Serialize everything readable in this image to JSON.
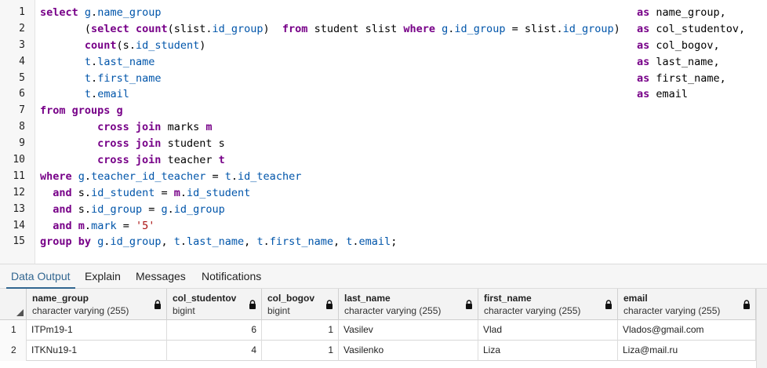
{
  "editor": {
    "lines": [
      {
        "num": "1",
        "code": [
          [
            "kw",
            "select "
          ],
          [
            "qual",
            "g"
          ],
          [
            "dot",
            "."
          ],
          [
            "qual",
            "name_group"
          ]
        ],
        "alias": [
          [
            "kw",
            "as "
          ],
          [
            "plain",
            "name_group,"
          ]
        ]
      },
      {
        "num": "2",
        "code": [
          [
            "plain",
            "       ("
          ],
          [
            "kw",
            "select "
          ],
          [
            "kw",
            "count"
          ],
          [
            "plain",
            "(slist"
          ],
          [
            "dot",
            "."
          ],
          [
            "qual",
            "id_group"
          ],
          [
            "plain",
            ")  "
          ],
          [
            "kw",
            "from "
          ],
          [
            "plain",
            "student slist "
          ],
          [
            "kw",
            "where "
          ],
          [
            "qual",
            "g"
          ],
          [
            "dot",
            "."
          ],
          [
            "qual",
            "id_group"
          ],
          [
            "plain",
            " = slist"
          ],
          [
            "dot",
            "."
          ],
          [
            "qual",
            "id_group"
          ],
          [
            "plain",
            ")"
          ]
        ],
        "alias": [
          [
            "kw",
            "as "
          ],
          [
            "plain",
            "col_studentov,"
          ]
        ]
      },
      {
        "num": "3",
        "code": [
          [
            "plain",
            "       "
          ],
          [
            "kw",
            "count"
          ],
          [
            "plain",
            "(s"
          ],
          [
            "dot",
            "."
          ],
          [
            "qual",
            "id_student"
          ],
          [
            "plain",
            ")"
          ]
        ],
        "alias": [
          [
            "kw",
            "as "
          ],
          [
            "plain",
            "col_bogov,"
          ]
        ]
      },
      {
        "num": "4",
        "code": [
          [
            "plain",
            "       "
          ],
          [
            "qual",
            "t"
          ],
          [
            "dot",
            "."
          ],
          [
            "qual",
            "last_name"
          ]
        ],
        "alias": [
          [
            "kw",
            "as "
          ],
          [
            "plain",
            "last_name,"
          ]
        ]
      },
      {
        "num": "5",
        "code": [
          [
            "plain",
            "       "
          ],
          [
            "qual",
            "t"
          ],
          [
            "dot",
            "."
          ],
          [
            "qual",
            "first_name"
          ]
        ],
        "alias": [
          [
            "kw",
            "as "
          ],
          [
            "plain",
            "first_name,"
          ]
        ]
      },
      {
        "num": "6",
        "code": [
          [
            "plain",
            "       "
          ],
          [
            "qual",
            "t"
          ],
          [
            "dot",
            "."
          ],
          [
            "qual",
            "email"
          ]
        ],
        "alias": [
          [
            "kw",
            "as "
          ],
          [
            "plain",
            "email"
          ]
        ]
      },
      {
        "num": "7",
        "code": [
          [
            "kw",
            "from "
          ],
          [
            "kw",
            "groups "
          ],
          [
            "kw",
            "g"
          ]
        ],
        "alias": []
      },
      {
        "num": "8",
        "code": [
          [
            "plain",
            "         "
          ],
          [
            "kw",
            "cross join "
          ],
          [
            "plain",
            "marks "
          ],
          [
            "kw",
            "m"
          ]
        ],
        "alias": []
      },
      {
        "num": "9",
        "code": [
          [
            "plain",
            "         "
          ],
          [
            "kw",
            "cross join "
          ],
          [
            "plain",
            "student s"
          ]
        ],
        "alias": []
      },
      {
        "num": "10",
        "code": [
          [
            "plain",
            "         "
          ],
          [
            "kw",
            "cross join "
          ],
          [
            "plain",
            "teacher "
          ],
          [
            "kw",
            "t"
          ]
        ],
        "alias": []
      },
      {
        "num": "11",
        "code": [
          [
            "kw",
            "where "
          ],
          [
            "qual",
            "g"
          ],
          [
            "dot",
            "."
          ],
          [
            "qual",
            "teacher_id_teacher"
          ],
          [
            "plain",
            " = "
          ],
          [
            "qual",
            "t"
          ],
          [
            "dot",
            "."
          ],
          [
            "qual",
            "id_teacher"
          ]
        ],
        "alias": []
      },
      {
        "num": "12",
        "code": [
          [
            "plain",
            "  "
          ],
          [
            "kw",
            "and "
          ],
          [
            "plain",
            "s"
          ],
          [
            "dot",
            "."
          ],
          [
            "qual",
            "id_student"
          ],
          [
            "plain",
            " = "
          ],
          [
            "kw",
            "m"
          ],
          [
            "dot",
            "."
          ],
          [
            "qual",
            "id_student"
          ]
        ],
        "alias": []
      },
      {
        "num": "13",
        "code": [
          [
            "plain",
            "  "
          ],
          [
            "kw",
            "and "
          ],
          [
            "plain",
            "s"
          ],
          [
            "dot",
            "."
          ],
          [
            "qual",
            "id_group"
          ],
          [
            "plain",
            " = "
          ],
          [
            "qual",
            "g"
          ],
          [
            "dot",
            "."
          ],
          [
            "qual",
            "id_group"
          ]
        ],
        "alias": []
      },
      {
        "num": "14",
        "code": [
          [
            "plain",
            "  "
          ],
          [
            "kw",
            "and "
          ],
          [
            "kw",
            "m"
          ],
          [
            "dot",
            "."
          ],
          [
            "qual",
            "mark"
          ],
          [
            "plain",
            " = "
          ],
          [
            "str",
            "'5'"
          ]
        ],
        "alias": []
      },
      {
        "num": "15",
        "code": [
          [
            "kw",
            "group by "
          ],
          [
            "qual",
            "g"
          ],
          [
            "dot",
            "."
          ],
          [
            "qual",
            "id_group"
          ],
          [
            "plain",
            ", "
          ],
          [
            "qual",
            "t"
          ],
          [
            "dot",
            "."
          ],
          [
            "qual",
            "last_name"
          ],
          [
            "plain",
            ", "
          ],
          [
            "qual",
            "t"
          ],
          [
            "dot",
            "."
          ],
          [
            "qual",
            "first_name"
          ],
          [
            "plain",
            ", "
          ],
          [
            "qual",
            "t"
          ],
          [
            "dot",
            "."
          ],
          [
            "qual",
            "email"
          ],
          [
            "plain",
            ";"
          ]
        ],
        "alias": []
      }
    ]
  },
  "tabs": [
    {
      "label": "Data Output",
      "active": true
    },
    {
      "label": "Explain",
      "active": false
    },
    {
      "label": "Messages",
      "active": false
    },
    {
      "label": "Notifications",
      "active": false
    }
  ],
  "grid": {
    "columns": [
      {
        "name": "name_group",
        "type": "character varying (255)"
      },
      {
        "name": "col_studentov",
        "type": "bigint"
      },
      {
        "name": "col_bogov",
        "type": "bigint"
      },
      {
        "name": "last_name",
        "type": "character varying (255)"
      },
      {
        "name": "first_name",
        "type": "character varying (255)"
      },
      {
        "name": "email",
        "type": "character varying (255)"
      }
    ],
    "rows": [
      {
        "num": "1",
        "cells": [
          "ITPm19-1",
          "6",
          "1",
          "Vasilev",
          "Vlad",
          "Vlados@gmail.com"
        ]
      },
      {
        "num": "2",
        "cells": [
          "ITKNu19-1",
          "4",
          "1",
          "Vasilenko",
          "Liza",
          "Liza@mail.ru"
        ]
      }
    ]
  },
  "colors": {
    "keyword": "#770088",
    "qualifier": "#0055aa",
    "string": "#aa1111",
    "active_tab": "#326690"
  },
  "icons": {
    "lock": "lock-icon",
    "sort": "sort-triangle-icon"
  }
}
